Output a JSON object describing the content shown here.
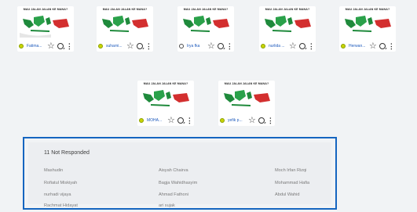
{
  "cards": [
    {
      "title": "MAU JALAN JALAN KE MANA?",
      "name": "Fatima...",
      "status": "submitted"
    },
    {
      "title": "MAU JALAN JALAN KE MANA?",
      "name": "suharni...",
      "status": "submitted"
    },
    {
      "title": "MAU JALAN JALAN KE MANA?",
      "name": "Irya fka",
      "status": "pending"
    },
    {
      "title": "MAU JALAN JALAN KE MANA?",
      "name": "nurlida ...",
      "status": "submitted"
    },
    {
      "title": "MAU JALAN JALAN KE MANA?",
      "name": "Herwan...",
      "status": "submitted"
    },
    {
      "title": "MAU JALAN JALAN KE MANA?",
      "name": "MOHA...",
      "status": "submitted"
    },
    {
      "title": "MAU JALAN JALAN KE MANA?",
      "name": "yefik p...",
      "status": "submitted"
    }
  ],
  "not_responded": {
    "title": "11 Not Responded",
    "names": [
      "Mashudin",
      "Aisyah Chairva",
      "Moch Irfan Rizqi",
      "Rofiatul Miskiyah",
      "Bagja Wahidhasyim",
      "Mohammad Hafia",
      "nurhadi vijaya",
      "Ahmad Fathoni",
      "Abdul Wahid",
      "Rachmat Hidayat",
      "ari sujak"
    ]
  },
  "colors": {
    "accent": "#1565c0",
    "name_link": "#1e5bbd",
    "status_dot": "#c8d400",
    "map_land": "#1f8a3c",
    "map_highlight": "#d32f2f"
  },
  "icons": [
    "star-icon",
    "comment-icon",
    "more-vertical-icon",
    "check-dot-icon"
  ]
}
